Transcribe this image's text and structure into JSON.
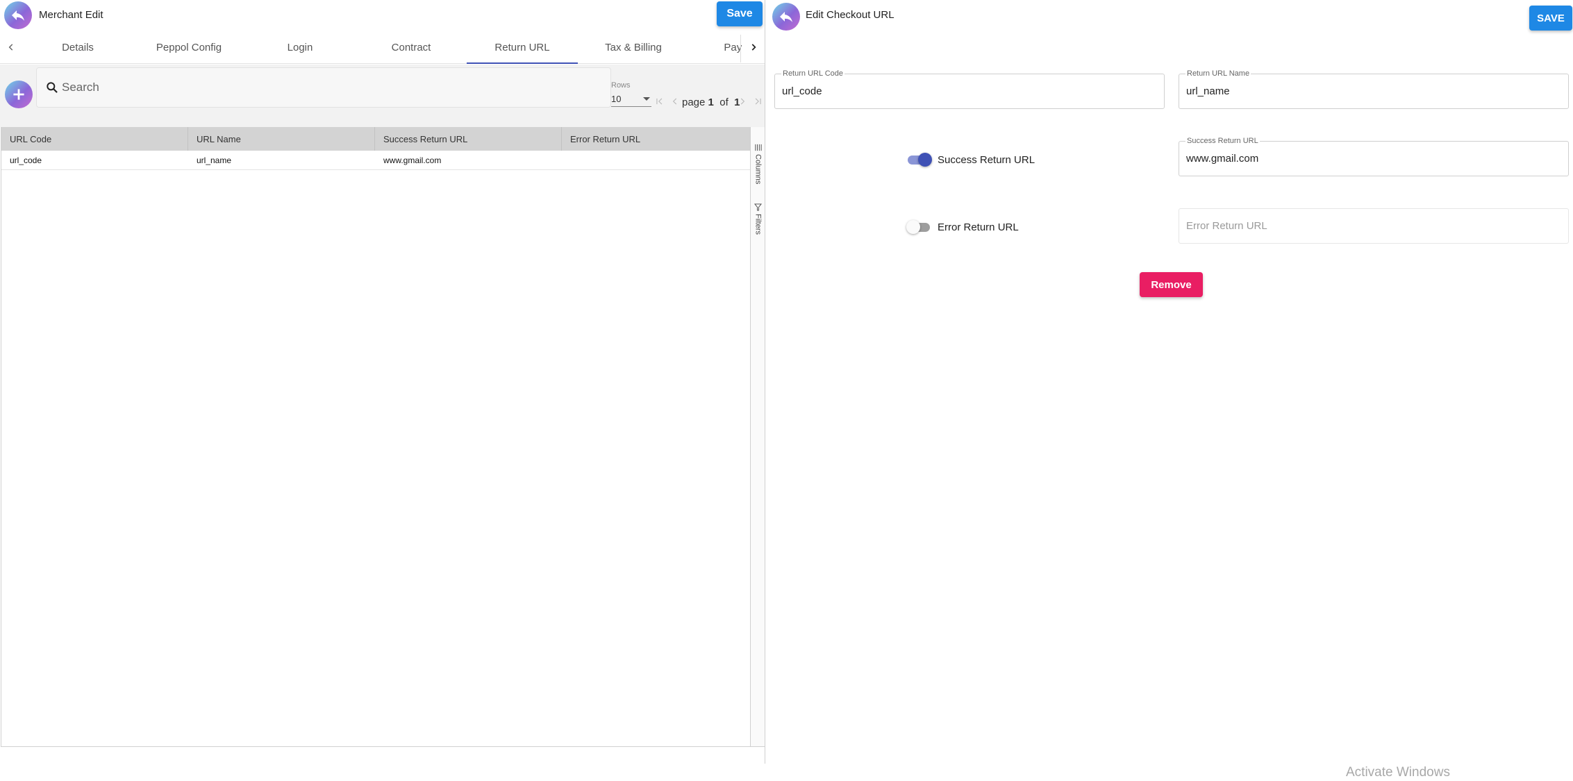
{
  "merchant": {
    "title": "Merchant Edit",
    "save_label": "Save",
    "tabs": [
      {
        "label": "Details"
      },
      {
        "label": "Peppol Config"
      },
      {
        "label": "Login"
      },
      {
        "label": "Contract"
      },
      {
        "label": "Return URL",
        "active": true
      },
      {
        "label": "Tax & Billing"
      },
      {
        "label": "Payment"
      }
    ],
    "search": {
      "placeholder": "Search",
      "value": ""
    },
    "pager": {
      "rows_label": "Rows",
      "rows_value": "10",
      "page_word": "page",
      "page": "1",
      "of_word": "of",
      "total": "1"
    },
    "grid": {
      "columns": [
        "URL Code",
        "URL Name",
        "Success Return URL",
        "Error Return URL"
      ],
      "rows": [
        {
          "code": "url_code",
          "name": "url_name",
          "success": "www.gmail.com",
          "error": ""
        }
      ]
    },
    "side_panel": {
      "columns_label": "Columns",
      "filters_label": "Filters"
    }
  },
  "checkout": {
    "title": "Edit Checkout URL",
    "save_label": "SAVE",
    "code_field": {
      "label": "Return URL Code",
      "value": "url_code"
    },
    "name_field": {
      "label": "Return URL Name",
      "value": "url_name"
    },
    "success_toggle": {
      "label": "Success Return URL",
      "on": true
    },
    "success_field": {
      "label": "Success Return URL",
      "value": "www.gmail.com"
    },
    "error_toggle": {
      "label": "Error Return URL",
      "on": false
    },
    "error_field": {
      "placeholder": "Error Return URL"
    },
    "remove_label": "Remove"
  },
  "os": {
    "watermark": "Activate Windows"
  },
  "colors": {
    "primary_blue": "#1e88e5",
    "indigo": "#3f51b5",
    "danger_pink": "#e91e63",
    "header_gray": "#d3d3d3"
  },
  "icons": [
    "back-arrow-icon",
    "plus-icon",
    "search-icon",
    "chevron-left-icon",
    "chevron-right-icon",
    "first-page-icon",
    "last-page-icon",
    "columns-icon",
    "filter-icon"
  ]
}
